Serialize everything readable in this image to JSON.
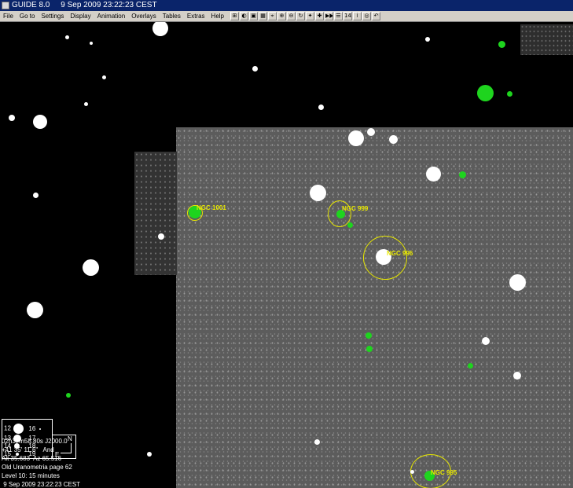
{
  "window": {
    "title": "GUIDE 8.0     9 Sep 2009 23:22:23 CEST"
  },
  "menu": [
    {
      "label": "File"
    },
    {
      "label": "Go to"
    },
    {
      "label": "Settings"
    },
    {
      "label": "Display"
    },
    {
      "label": "Animation"
    },
    {
      "label": "Overlays"
    },
    {
      "label": "Tables"
    },
    {
      "label": "Extras"
    },
    {
      "label": "Help"
    }
  ],
  "toolbar": [
    {
      "icon": "grid-icon",
      "glyph": "⊞"
    },
    {
      "icon": "globe-icon",
      "glyph": "◐"
    },
    {
      "icon": "image-icon",
      "glyph": "▣"
    },
    {
      "icon": "camera-icon",
      "glyph": "▦"
    },
    {
      "icon": "telescope-icon",
      "glyph": "⌖"
    },
    {
      "icon": "zoom-in-icon",
      "glyph": "⊕"
    },
    {
      "icon": "zoom-out-icon",
      "glyph": "⊖"
    },
    {
      "icon": "rotate-icon",
      "glyph": "↻"
    },
    {
      "icon": "star-icon",
      "glyph": "✦"
    },
    {
      "icon": "cross-icon",
      "glyph": "✚"
    },
    {
      "icon": "fast-forward-icon",
      "glyph": "▶▶"
    },
    {
      "icon": "list-icon",
      "glyph": "☰"
    },
    {
      "icon": "level-icon",
      "glyph": "14"
    },
    {
      "icon": "info-icon",
      "glyph": "i"
    },
    {
      "icon": "target-icon",
      "glyph": "◎"
    },
    {
      "icon": "undo-icon",
      "glyph": "↶"
    }
  ],
  "galaxies": [
    {
      "label": "NGC 1001"
    },
    {
      "label": "NGC 999"
    },
    {
      "label": "NGC 996"
    },
    {
      "label": "NGC 995"
    }
  ],
  "legend": {
    "rows": [
      {
        "left": "12",
        "right": "16"
      },
      {
        "left": "13",
        "right": "17"
      },
      {
        "left": "14",
        "right": "18"
      },
      {
        "left": "15",
        "right": "19"
      }
    ],
    "north": "N",
    "east": "E"
  },
  "info": {
    "ra": "02h37m58.80s J2000.0",
    "dec": "+41 35' 11.6\"   And",
    "altaz": "Alt 35.683  Az 65.516",
    "atlas": "Old Uranometria page 62",
    "level": "Level 10: 15 minutes",
    "datetime": " 9 Sep 2009 23:22:23 CEST"
  },
  "colors": {
    "catalog_star": "#ffffff",
    "highlight_star": "#1ed41e",
    "galaxy_ring": "#e6e600",
    "titlebar": "#0a246a"
  }
}
